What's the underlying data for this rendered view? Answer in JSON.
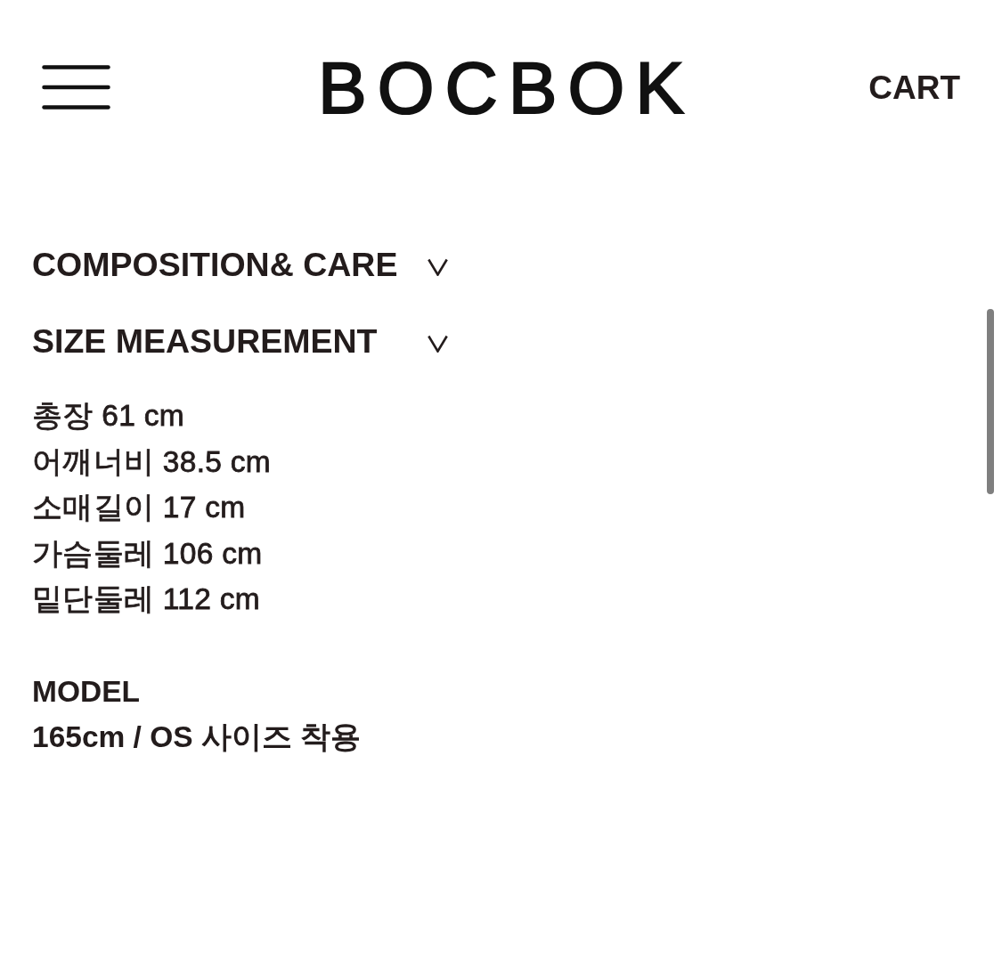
{
  "header": {
    "logo": "BOCBOK",
    "cart": "CART"
  },
  "sections": [
    {
      "title": "COMPOSITION& CARE"
    },
    {
      "title": "SIZE MEASUREMENT",
      "lines": [
        "총장 61 cm",
        "어깨너비 38.5 cm",
        "소매길이 17 cm",
        "가슴둘레 106 cm",
        "밑단둘레 112 cm"
      ]
    }
  ],
  "model": {
    "label": "MODEL",
    "text": "165cm / OS 사이즈 착용"
  }
}
